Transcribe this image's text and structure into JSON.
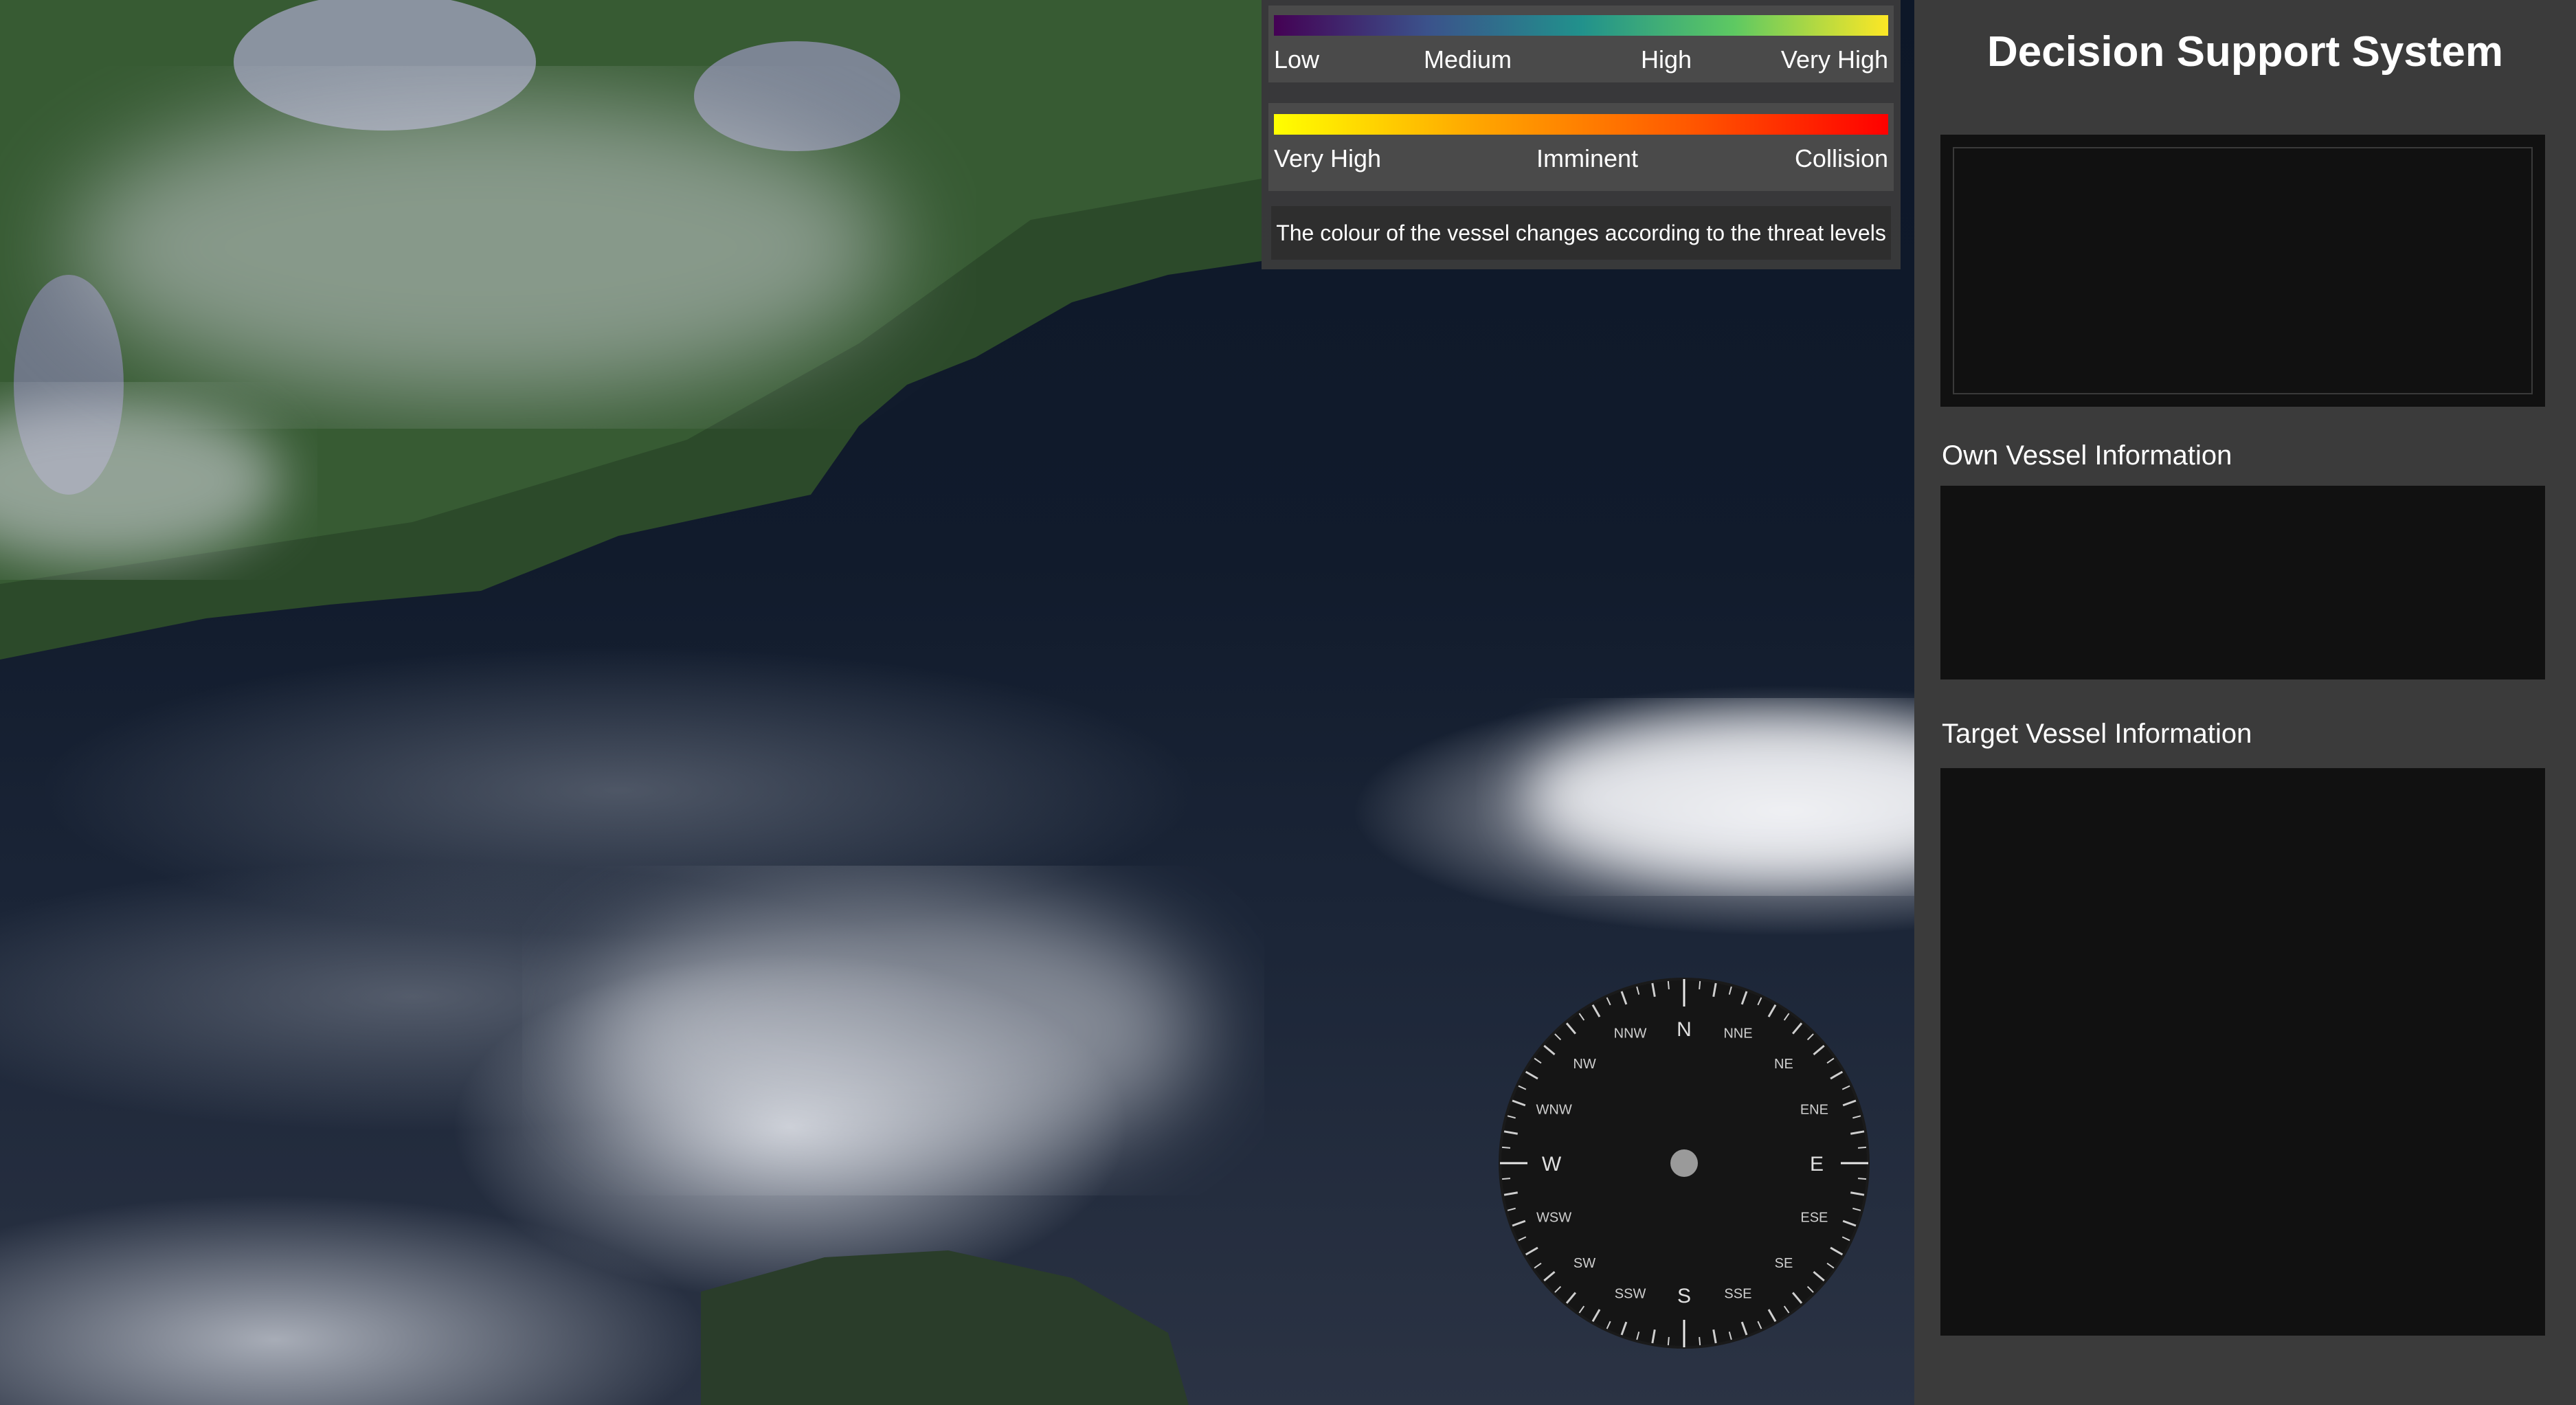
{
  "legend": {
    "risk_scale": {
      "colors": [
        "#440154",
        "#3b528b",
        "#21918c",
        "#5ec962",
        "#fde725"
      ],
      "labels": [
        "Low",
        "Medium",
        "High",
        "Very High"
      ]
    },
    "threat_scale": {
      "colors": [
        "#ffff00",
        "#ffa500",
        "#ff5a00",
        "#ff0000"
      ],
      "labels": [
        "Very High",
        "Imminent",
        "Collision"
      ]
    },
    "note": "The colour of the vessel changes according to the threat levels"
  },
  "panel": {
    "title": "Decision Support System",
    "own_vessel_label": "Own Vessel Information",
    "target_vessel_label": "Target Vessel Information"
  },
  "compass": {
    "cardinals": [
      "N",
      "E",
      "S",
      "W"
    ],
    "intercardinals": [
      "NNE",
      "NE",
      "ENE",
      "ESE",
      "SE",
      "SSE",
      "SSW",
      "SW",
      "WSW",
      "WNW",
      "NW",
      "NNW"
    ]
  }
}
